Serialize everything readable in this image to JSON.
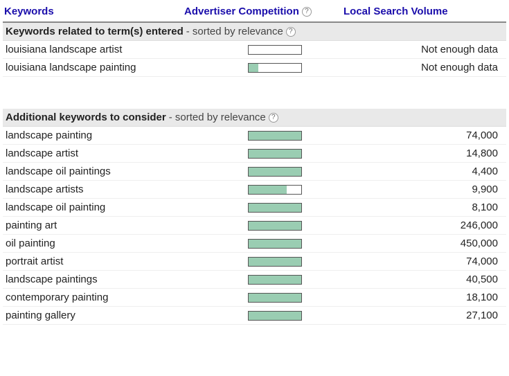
{
  "columns": {
    "keywords": "Keywords",
    "competition": "Advertiser Competition",
    "volume": "Local Search Volume"
  },
  "section1": {
    "title": "Keywords related to term(s) entered",
    "subtitle": "- sorted by relevance",
    "rows": [
      {
        "keyword": "louisiana landscape artist",
        "competition_pct": 0,
        "volume": "Not enough data"
      },
      {
        "keyword": "louisiana landscape painting",
        "competition_pct": 18,
        "volume": "Not enough data"
      }
    ]
  },
  "section2": {
    "title": "Additional keywords to consider",
    "subtitle": "- sorted by relevance",
    "rows": [
      {
        "keyword": "landscape painting",
        "competition_pct": 100,
        "volume": "74,000"
      },
      {
        "keyword": "landscape artist",
        "competition_pct": 100,
        "volume": "14,800"
      },
      {
        "keyword": "landscape oil paintings",
        "competition_pct": 100,
        "volume": "4,400"
      },
      {
        "keyword": "landscape artists",
        "competition_pct": 72,
        "volume": "9,900"
      },
      {
        "keyword": "landscape oil painting",
        "competition_pct": 100,
        "volume": "8,100"
      },
      {
        "keyword": "painting art",
        "competition_pct": 100,
        "volume": "246,000"
      },
      {
        "keyword": "oil painting",
        "competition_pct": 100,
        "volume": "450,000"
      },
      {
        "keyword": "portrait artist",
        "competition_pct": 100,
        "volume": "74,000"
      },
      {
        "keyword": "landscape paintings",
        "competition_pct": 100,
        "volume": "40,500"
      },
      {
        "keyword": "contemporary painting",
        "competition_pct": 100,
        "volume": "18,100"
      },
      {
        "keyword": "painting gallery",
        "competition_pct": 100,
        "volume": "27,100"
      }
    ]
  }
}
